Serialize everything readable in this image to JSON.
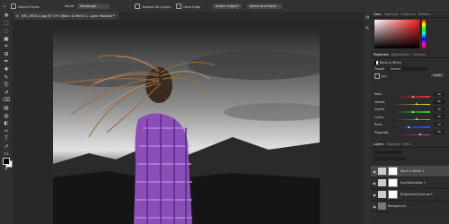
{
  "options_bar": {
    "object_finder_label": "Object Finder",
    "mode_label": "Mode:",
    "mode_value": "Rectangle",
    "sample_all_layers_label": "Sample All Layers",
    "hard_edge_label": "Hard Edge",
    "select_subject_label": "Select Subject",
    "select_and_mask_label": "Select and Mask..."
  },
  "document_tab": {
    "title": "IMG_0935-2.jpg @ 17% (Black & White 1, Layer Mask/8) *"
  },
  "right_panels": {
    "color_panel_tabs": [
      "Color",
      "Swatches",
      "Gradients",
      "Patterns"
    ],
    "properties_tabs": [
      "Properties",
      "Adjustments",
      "Libraries"
    ],
    "adjustment_name": "Black & White",
    "preset_label": "Preset:",
    "preset_value": "Default",
    "tint_label": "Tint",
    "auto_label": "Auto",
    "sliders": [
      {
        "label": "Reds",
        "value": "40",
        "fraction": 0.55,
        "color": "linear-gradient(90deg,#222,#e33)"
      },
      {
        "label": "Yellows",
        "value": "60",
        "fraction": 0.65,
        "color": "linear-gradient(90deg,#222,#ee3)"
      },
      {
        "label": "Greens",
        "value": "40",
        "fraction": 0.55,
        "color": "linear-gradient(90deg,#222,#3c3)"
      },
      {
        "label": "Cyans",
        "value": "60",
        "fraction": 0.65,
        "color": "linear-gradient(90deg,#222,#3cc)"
      },
      {
        "label": "Blues",
        "value": "20",
        "fraction": 0.45,
        "color": "linear-gradient(90deg,#222,#35e)"
      },
      {
        "label": "Magentas",
        "value": "80",
        "fraction": 0.75,
        "color": "linear-gradient(90deg,#222,#d3d)"
      }
    ],
    "layers_tabs": [
      "Layers",
      "Channels",
      "Paths"
    ],
    "layers": [
      {
        "name": "Black & White 1",
        "selected": true
      },
      {
        "name": "Hue/Saturation 1",
        "selected": false
      },
      {
        "name": "Brightness/Contrast 1",
        "selected": false
      },
      {
        "name": "Background",
        "selected": false
      }
    ]
  },
  "toolbar": {
    "tools": [
      "move-tool",
      "marquee-tool",
      "lasso-tool",
      "object-selection-tool",
      "crop-tool",
      "frame-tool",
      "eyedropper-tool",
      "healing-brush-tool",
      "brush-tool",
      "clone-stamp-tool",
      "history-brush-tool",
      "eraser-tool",
      "gradient-tool",
      "blur-tool",
      "dodge-tool",
      "pen-tool",
      "type-tool",
      "path-selection-tool",
      "rectangle-tool",
      "hand-tool",
      "zoom-tool"
    ]
  }
}
